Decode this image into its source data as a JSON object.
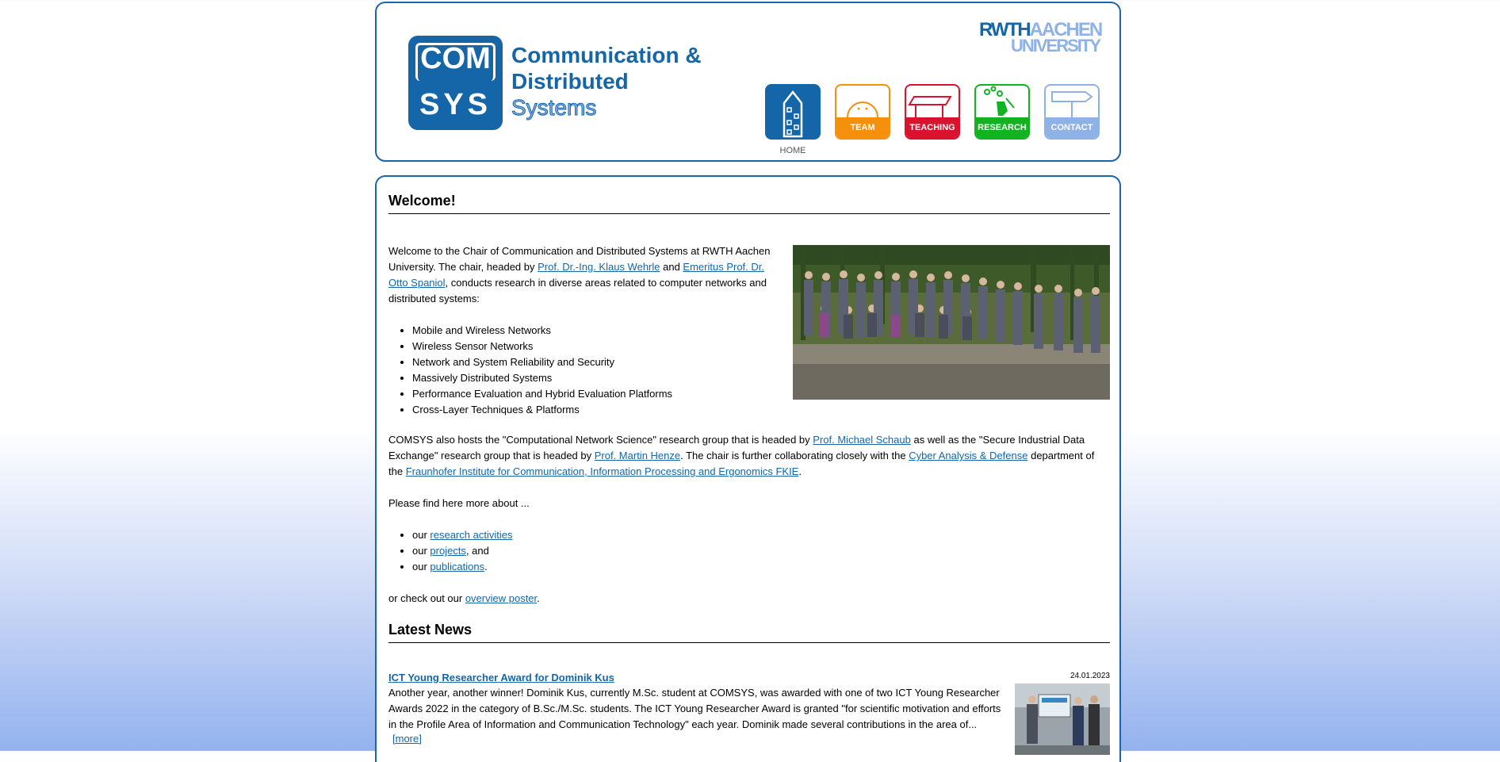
{
  "header": {
    "logo": {
      "top": "COM",
      "bottom": "SYS"
    },
    "title_lines": [
      "Communication &",
      "Distributed",
      "Systems"
    ],
    "university": {
      "rwth": "RWTH",
      "aachen": "AACHEN",
      "university": "UNIVERSITY"
    },
    "nav": [
      {
        "label": "HOME",
        "color": "#1466a8",
        "icon": "building-icon"
      },
      {
        "label": "TEAM",
        "color": "#f5900c",
        "icon": "smiley-icon"
      },
      {
        "label": "TEACHING",
        "color": "#d9132d",
        "icon": "desk-icon"
      },
      {
        "label": "RESEARCH",
        "color": "#12b321",
        "icon": "flask-icon"
      },
      {
        "label": "CONTACT",
        "color": "#8fb2e6",
        "icon": "signpost-icon"
      }
    ],
    "active_nav_caption": "HOME"
  },
  "welcome": {
    "heading": "Welcome!",
    "intro_1": "Welcome to the Chair of Communication and Distributed Systems at RWTH Aachen University. The chair, headed by ",
    "link_wehrle": "Prof. Dr.-Ing. Klaus Wehrle",
    "intro_2": " and ",
    "link_spaniol": "Emeritus Prof. Dr. Otto Spaniol",
    "intro_3": ", conducts research in diverse areas related to computer networks and distributed systems:",
    "topics": [
      "Mobile and Wireless Networks",
      "Wireless Sensor Networks",
      "Network and System Reliability and Security",
      "Massively Distributed Systems",
      "Performance Evaluation and Hybrid Evaluation Platforms",
      "Cross-Layer Techniques & Platforms"
    ],
    "p2_1": "COMSYS also hosts the \"Computational Network Science\" research group that is headed by ",
    "link_schaub": "Prof. Michael Schaub",
    "p2_2": " as well as the \"Secure Industrial Data Exchange\" research group that is headed by ",
    "link_henze": "Prof. Martin Henze",
    "p2_3": ". The chair is further collaborating closely with the ",
    "link_cad": "Cyber Analysis & Defense",
    "p2_4": " department of the ",
    "link_fkie": "Fraunhofer Institute for Communication, Information Processing and Ergonomics FKIE",
    "p2_5": ".",
    "p3": "Please find here more about ...",
    "more_items": [
      {
        "prefix": "our ",
        "link": "research activities",
        "suffix": ""
      },
      {
        "prefix": "our ",
        "link": "projects",
        "suffix": ", and"
      },
      {
        "prefix": "our ",
        "link": "publications",
        "suffix": "."
      }
    ],
    "p4_1": "or check out our ",
    "link_poster": "overview poster",
    "p4_2": "."
  },
  "news": {
    "heading": "Latest News",
    "items": [
      {
        "title": "ICT Young Researcher Award for Dominik Kus",
        "date": "24.01.2023",
        "body": "Another year, another winner! Dominik Kus, currently M.Sc. student at COMSYS, was awarded with one of two ICT Young Researcher Awards 2022 in the category of B.Sc./M.Sc. students. The ICT Young Researcher Award is granted \"for scientific motivation and efforts in the Profile Area of Information and Communication Technology\" each year. Dominik made several contributions in the area of...",
        "more": "[more]"
      }
    ]
  }
}
